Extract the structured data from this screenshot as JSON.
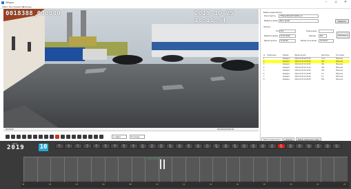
{
  "window": {
    "title": "VPlayer",
    "minimize": "–",
    "restore": "▫",
    "close": "✕"
  },
  "menu": [
    "Файл",
    "Инструменты",
    "Помощь"
  ],
  "video": {
    "osd_left": "0018388_000000",
    "osd_right": "2019-10-25 10:10:54"
  },
  "timeline": {
    "left_time": "00:00:00",
    "right_time": "00:00:00 00:00:04"
  },
  "controls": {
    "speed": "1 кадр/с",
    "mode": "По всему"
  },
  "panel": {
    "device_group": "Выбор видеозаписи",
    "registrar_label": "Регистратор",
    "registrar_value": "VTRanaoRider18 (S/N11_2)",
    "source_label": "Выбрать архив",
    "source_value": "Весь архив",
    "select_btn": "Выбрать",
    "filter_group": "Фильтр",
    "type_label": "Тип",
    "type_value": "Все",
    "event_label": "Тревожные",
    "event_value": "",
    "date_from_label": "Выбрать время",
    "date_from_value": "25.10.2019",
    "date_to_label": "Камера",
    "date_to_value": "Все",
    "start_label": "Время начала",
    "start_value": "10:00:00",
    "end_label": "Время окончания",
    "end_value": "23:59:59",
    "apply_btn": "Применить"
  },
  "events": {
    "columns": [
      "№",
      "Тревожные",
      "Камера",
      "Время начала",
      "Длительн.",
      "Состояние"
    ],
    "rows": [
      [
        "1",
        "",
        "Камера1",
        "2019-10-25 09:57:55",
        "3:1s",
        "Обычное"
      ],
      [
        "2",
        "",
        "Камера1",
        "2019-10-25 10:00:00",
        "30s",
        "Обычное"
      ],
      [
        "3",
        "",
        "Камера1",
        "2019-10-25 10:10:30",
        "30s",
        "Обычное"
      ],
      [
        "4",
        "",
        "Камера1",
        "2019-10-25 10:11:10",
        "30s",
        "Обычное"
      ],
      [
        "5",
        "",
        "Камера1",
        "2019-10-25 10:12:00",
        "30s",
        "Обычное"
      ],
      [
        "6",
        "",
        "Камера1",
        "2019-10-25 10:14:08",
        "5:1",
        "Обычное"
      ],
      [
        "7",
        "",
        "Камера1",
        "2019-10-25 10:16:20",
        "5:1",
        "Обычное"
      ],
      [
        "8",
        "",
        "Камера1",
        "2019-10-25 10:20:00",
        "30s",
        "Обычное"
      ]
    ],
    "selected_row": 1
  },
  "tabs": [
    "Выбор видеозаписи",
    "Журнал",
    "Выбор тревожных событ"
  ],
  "calendar": {
    "year": "2019",
    "year_small": "2019",
    "month": "10",
    "days": [
      "1",
      "2",
      "3",
      "4",
      "5",
      "6",
      "7",
      "8",
      "9",
      "10",
      "11",
      "12",
      "13",
      "14",
      "15",
      "16",
      "17",
      "18",
      "19",
      "20",
      "21",
      "22",
      "23",
      "24",
      "25",
      "26",
      "27",
      "28",
      "29",
      "30",
      "31"
    ],
    "active_day": "25",
    "weekdays": [
      "Вт",
      "Ср",
      "Чт",
      "Пт",
      "Сб",
      "Вс",
      "Пн",
      "Вт",
      "Ср",
      "Чт",
      "Пт",
      "Сб",
      "Вс",
      "Пн",
      "Вт",
      "Ср",
      "Чт",
      "Пт",
      "Сб",
      "Вс",
      "Пн",
      "Вт",
      "Ср",
      "Чт",
      "Пт",
      "Сб",
      "Вс",
      "Пн",
      "Вт",
      "Ср",
      "Чт"
    ]
  },
  "hours": {
    "marker": "2019-10-25 10:02",
    "labels": [
      "00",
      "01",
      "02",
      "03",
      "04",
      "05",
      "06",
      "07",
      "08",
      "09",
      "10",
      "11",
      "12",
      "13",
      "14",
      "15",
      "16",
      "17",
      "18",
      "19",
      "20",
      "21",
      "22",
      "23"
    ]
  },
  "axis": [
    "00",
    "02",
    "04",
    "06",
    "08",
    "10",
    "12",
    "14",
    "16",
    "18",
    "20",
    "22",
    "24"
  ],
  "colors": {
    "accent": "#2aa8d6",
    "active_day": "#e02020",
    "highlight": "#ffff33"
  }
}
